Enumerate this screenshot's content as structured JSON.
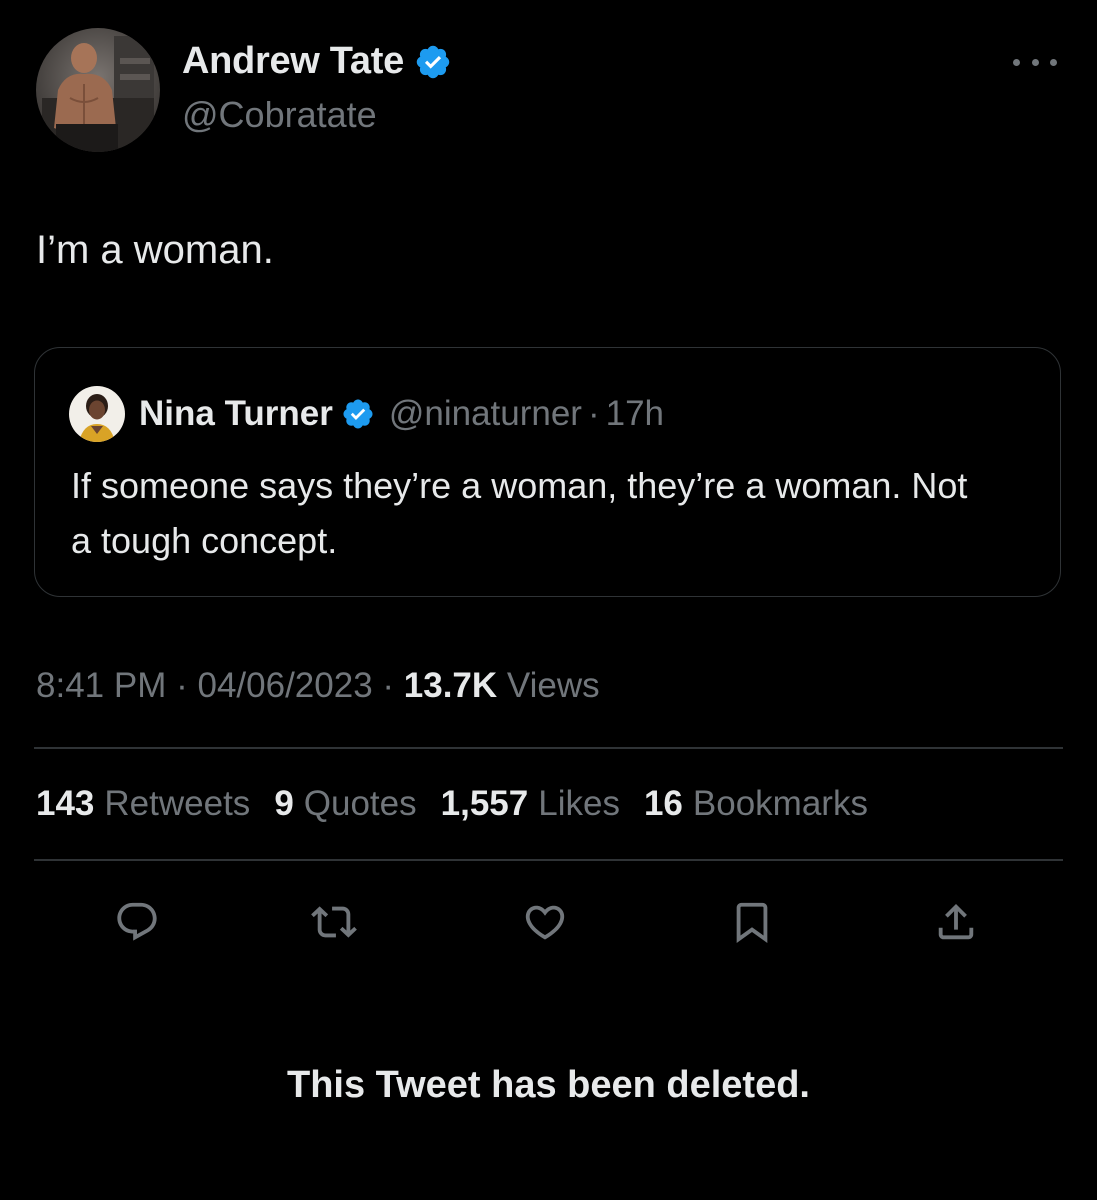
{
  "tweet": {
    "author": {
      "name": "Andrew Tate",
      "handle": "@Cobratate",
      "verified": true,
      "avatar_icon": "profile-photo"
    },
    "text": "I’m a woman.",
    "more_icon": "more-horizontal-icon"
  },
  "quoted_tweet": {
    "author": {
      "name": "Nina Turner",
      "handle": "@ninaturner",
      "verified": true
    },
    "separator": "·",
    "time": "17h",
    "text": "If someone says they’re a woman, they’re a woman. Not a tough concept."
  },
  "meta": {
    "time": "8:41 PM",
    "separator": "·",
    "date": "04/06/2023",
    "views_count": "13.7K",
    "views_label": "Views"
  },
  "stats": {
    "retweets": {
      "count": "143",
      "label": "Retweets"
    },
    "quotes": {
      "count": "9",
      "label": "Quotes"
    },
    "likes": {
      "count": "1,557",
      "label": "Likes"
    },
    "bookmarks": {
      "count": "16",
      "label": "Bookmarks"
    }
  },
  "actions": [
    "reply-icon",
    "retweet-icon",
    "like-icon",
    "bookmark-icon",
    "share-icon"
  ],
  "notice": "This Tweet has been deleted.",
  "colors": {
    "background": "#000000",
    "primary_text": "#e7e9ea",
    "secondary_text": "#71767b",
    "border": "#2f3336",
    "verified_blue": "#1d9bf0"
  }
}
